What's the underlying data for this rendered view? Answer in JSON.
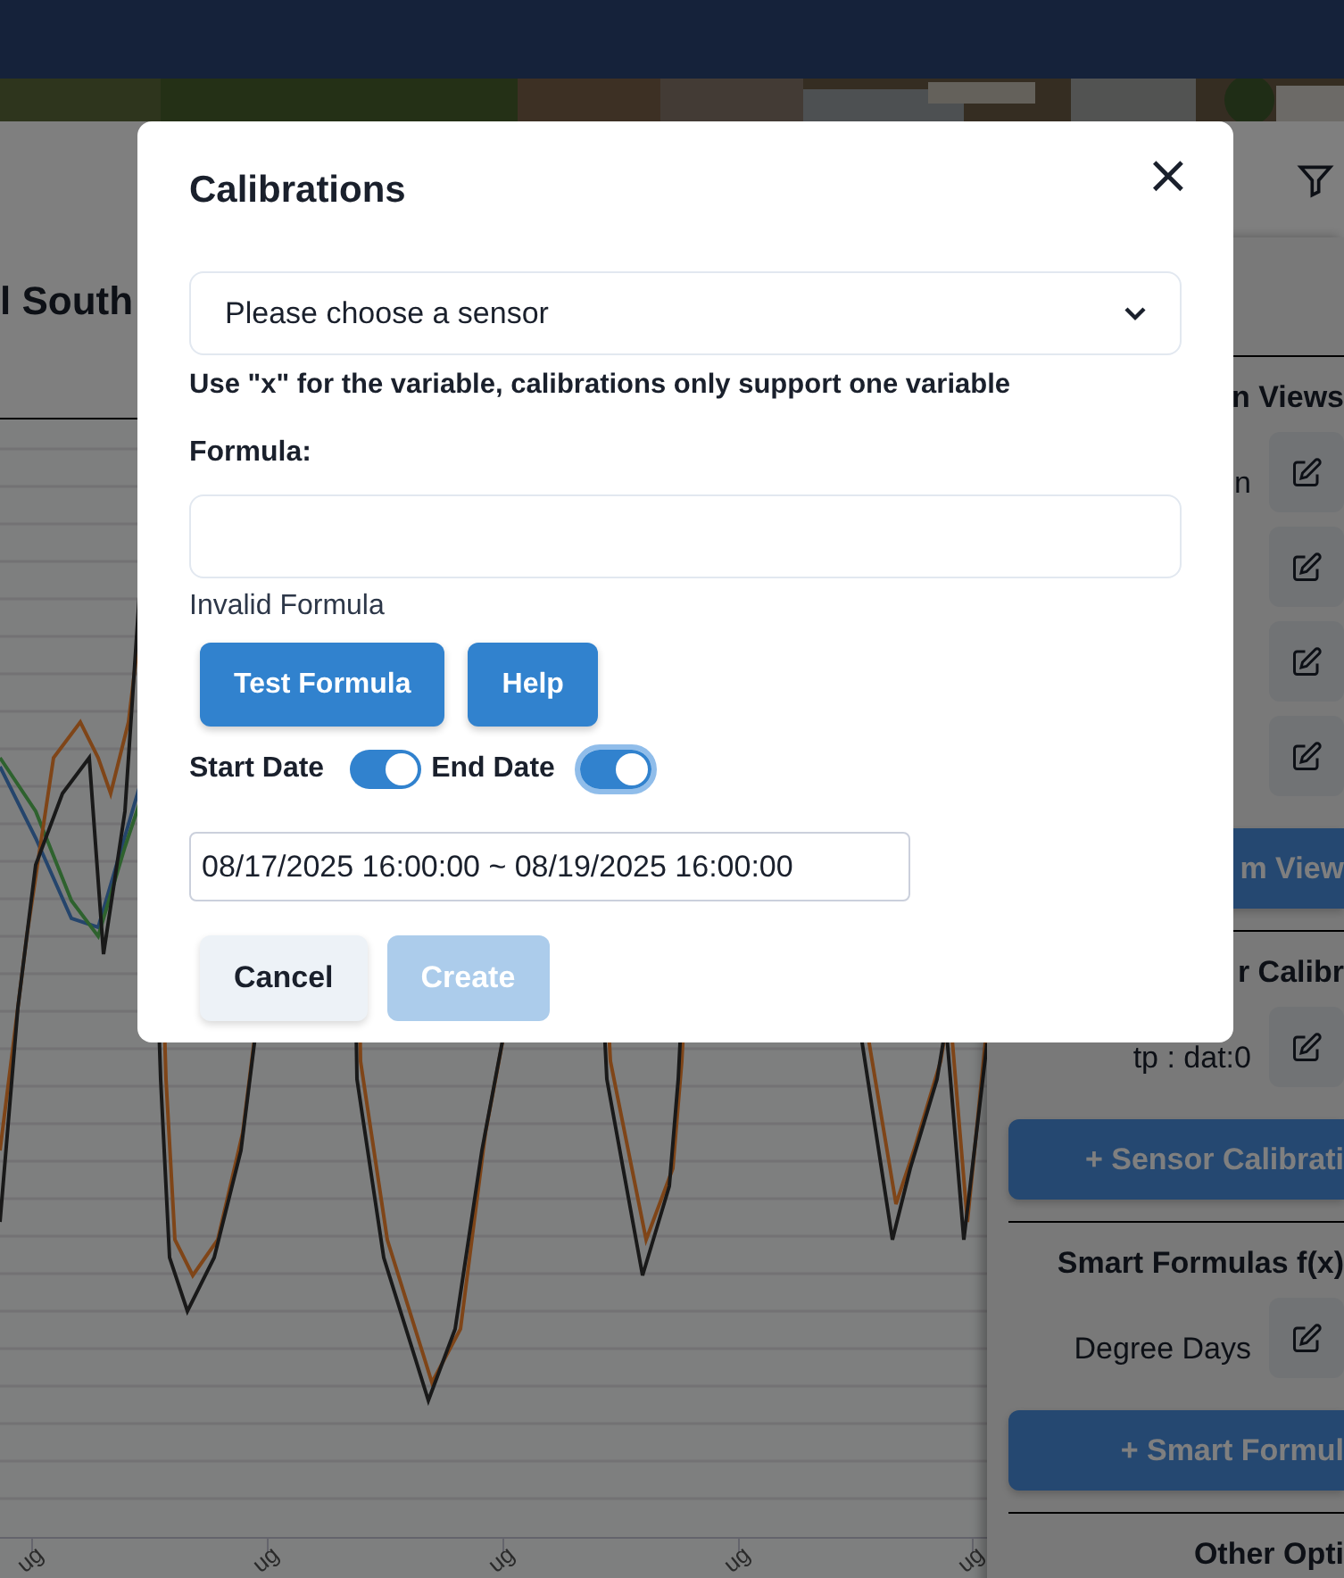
{
  "page": {
    "heading": "l South"
  },
  "chart": {
    "x_tick_labels": [
      "ug",
      "ug",
      "ug",
      "ug",
      "ug"
    ]
  },
  "side_panel": {
    "sections": [
      {
        "heading": "n Views",
        "items": [
          {
            "kind": "labeled",
            "label": "n"
          },
          {
            "kind": "edit_only"
          },
          {
            "kind": "edit_only"
          },
          {
            "kind": "edit_only"
          }
        ],
        "button": "m View"
      },
      {
        "heading": "r Calibr",
        "items": [
          {
            "kind": "labeled",
            "label": "tp : dat:0"
          }
        ],
        "button": "+ Sensor Calibrati"
      },
      {
        "heading": "Smart Formulas f(x)",
        "items": [
          {
            "kind": "labeled",
            "label": "Degree Days"
          }
        ],
        "button": "+ Smart Formul"
      },
      {
        "heading": "Other Opti"
      }
    ]
  },
  "dialog": {
    "title": "Calibrations",
    "close": "×",
    "sensor_select": {
      "placeholder": "Please choose a sensor"
    },
    "hint": "Use \"x\" for the variable, calibrations only support one variable",
    "formula_label": "Formula:",
    "formula_status": "Invalid Formula",
    "formula_buttons": [
      {
        "label": "Test Formula"
      },
      {
        "label": "Help"
      }
    ],
    "toggles": [
      {
        "label": "Start Date",
        "on": true,
        "focused": false
      },
      {
        "label": "End Date",
        "on": true,
        "focused": true
      }
    ],
    "date_range": "08/17/2025 16:00:00 ~ 08/19/2025 16:00:00",
    "footer_buttons": [
      {
        "label": "Cancel",
        "kind": "secondary",
        "disabled": false
      },
      {
        "label": "Create",
        "kind": "primary",
        "disabled": true
      }
    ]
  }
}
